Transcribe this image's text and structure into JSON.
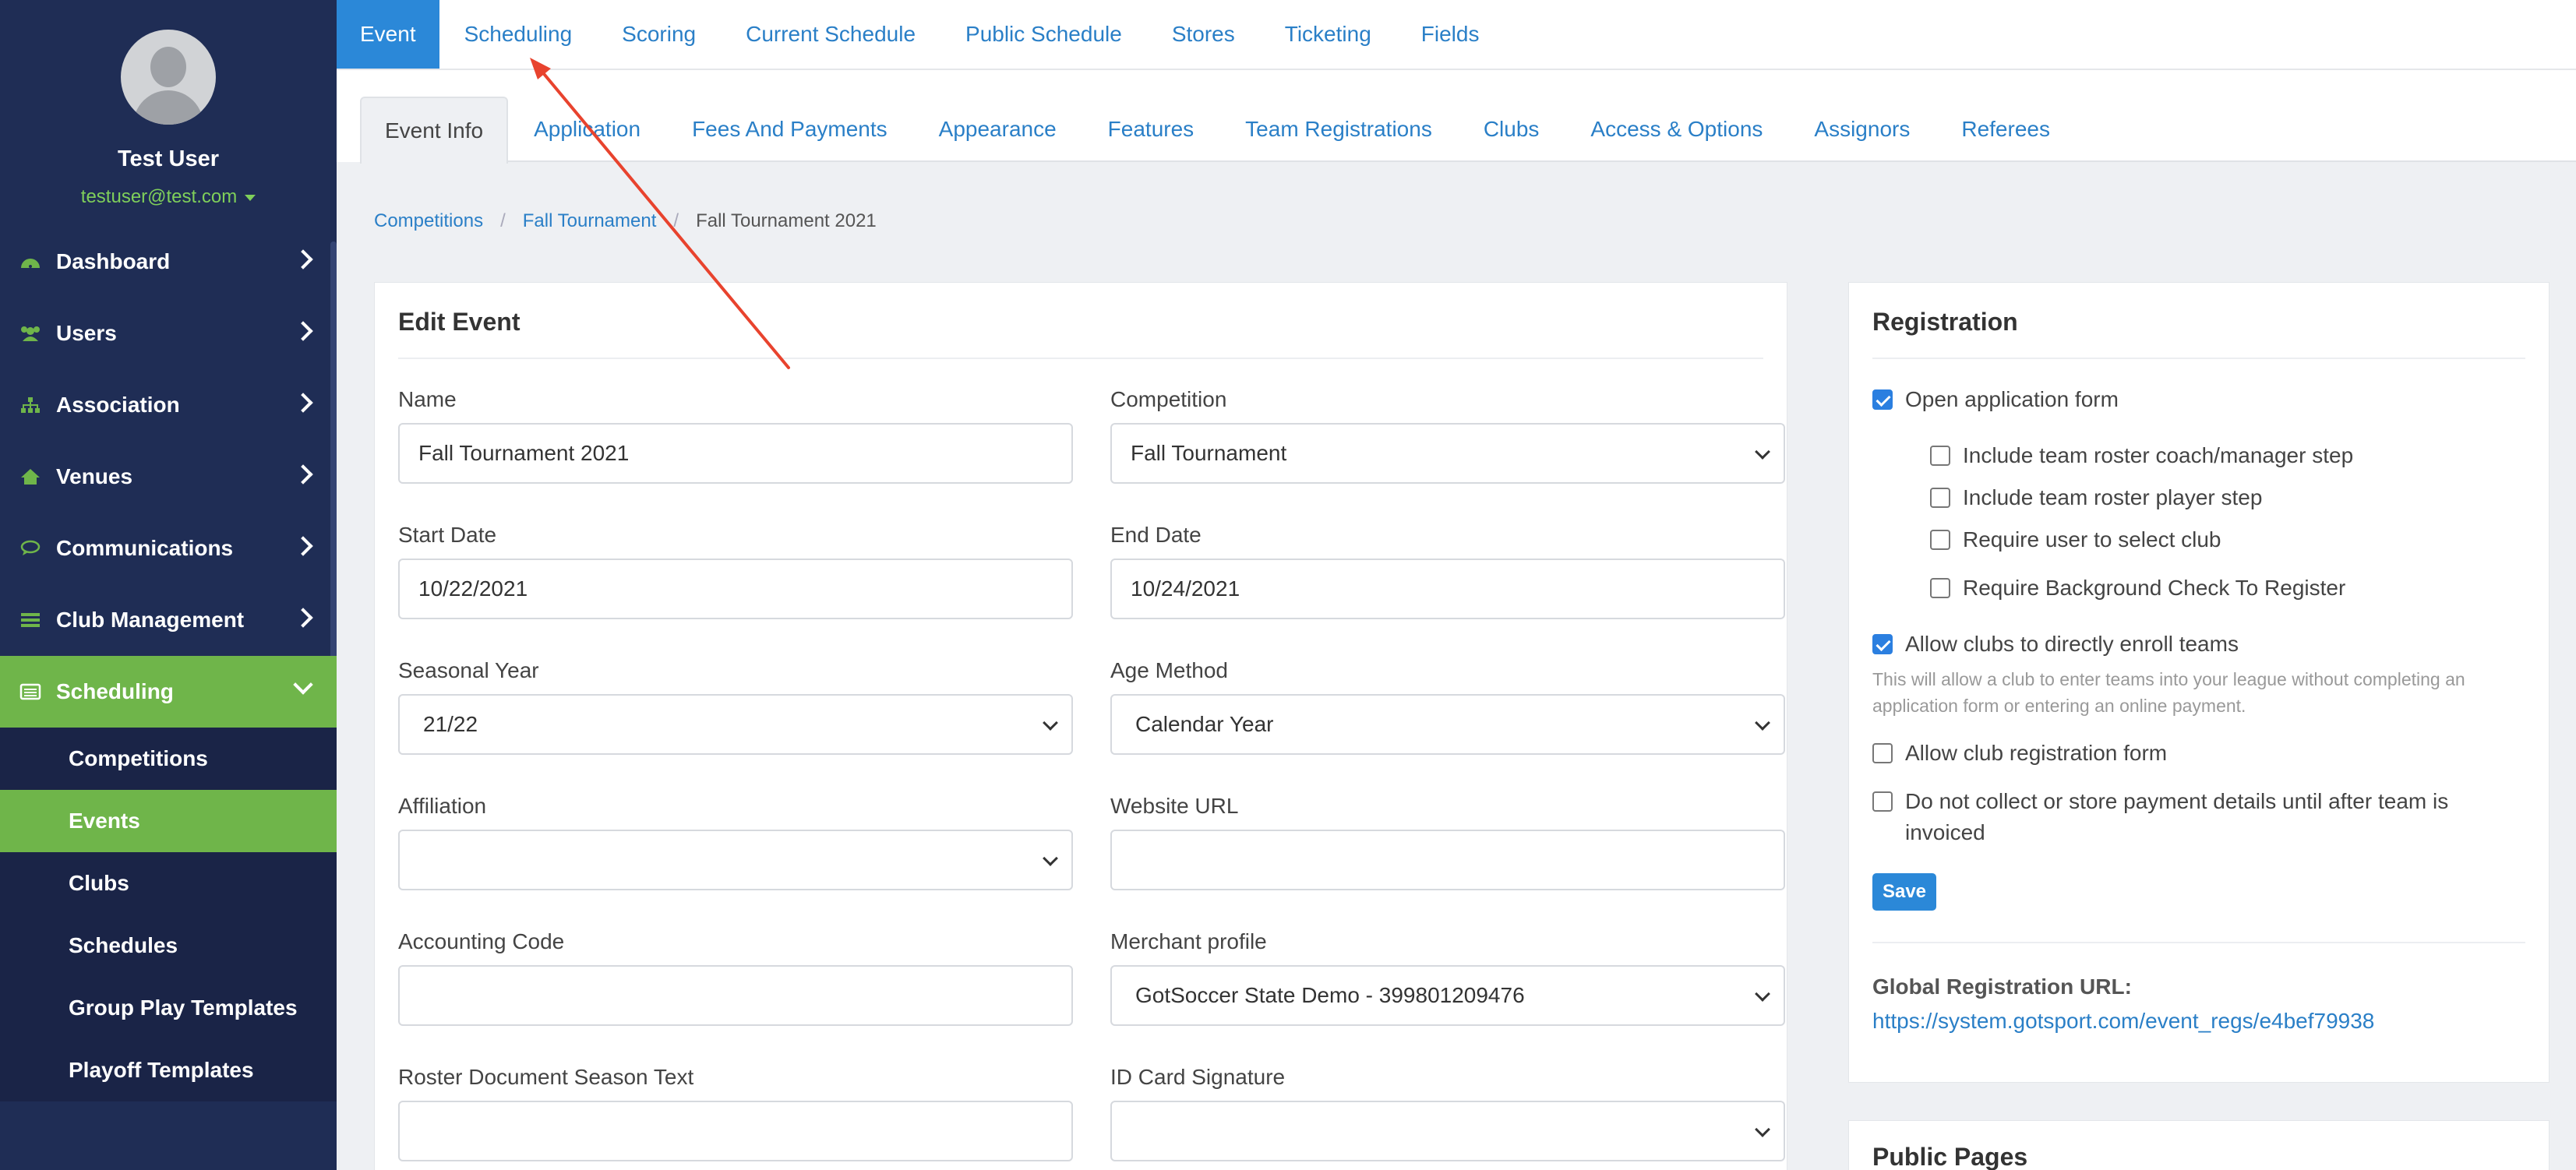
{
  "user": {
    "name": "Test User",
    "email": "testuser@test.com"
  },
  "sidebar": {
    "items": [
      {
        "label": "Dashboard",
        "icon": "dashboard-icon"
      },
      {
        "label": "Users",
        "icon": "users-icon"
      },
      {
        "label": "Association",
        "icon": "sitemap-icon"
      },
      {
        "label": "Venues",
        "icon": "home-icon"
      },
      {
        "label": "Communications",
        "icon": "chat-icon"
      },
      {
        "label": "Club Management",
        "icon": "list-icon"
      },
      {
        "label": "Scheduling",
        "icon": "calendar-list-icon"
      }
    ],
    "sub_items": [
      "Competitions",
      "Events",
      "Clubs",
      "Schedules",
      "Group Play Templates",
      "Playoff Templates"
    ]
  },
  "topnav": [
    "Event",
    "Scheduling",
    "Scoring",
    "Current Schedule",
    "Public Schedule",
    "Stores",
    "Ticketing",
    "Fields"
  ],
  "subnav": [
    "Event Info",
    "Application",
    "Fees And Payments",
    "Appearance",
    "Features",
    "Team Registrations",
    "Clubs",
    "Access & Options",
    "Assignors",
    "Referees"
  ],
  "breadcrumb": [
    "Competitions",
    "Fall Tournament",
    "Fall Tournament 2021"
  ],
  "edit_event": {
    "title": "Edit Event",
    "fields": {
      "name": {
        "label": "Name",
        "value": "Fall Tournament 2021"
      },
      "competition": {
        "label": "Competition",
        "value": "Fall Tournament"
      },
      "start_date": {
        "label": "Start Date",
        "value": "10/22/2021"
      },
      "end_date": {
        "label": "End Date",
        "value": "10/24/2021"
      },
      "seasonal_year": {
        "label": "Seasonal Year",
        "value": "21/22"
      },
      "age_method": {
        "label": "Age Method",
        "value": "Calendar Year"
      },
      "affiliation": {
        "label": "Affiliation",
        "value": ""
      },
      "website_url": {
        "label": "Website URL",
        "value": ""
      },
      "accounting_code": {
        "label": "Accounting Code",
        "value": ""
      },
      "merchant_profile": {
        "label": "Merchant profile",
        "value": "GotSoccer State Demo - 399801209476"
      },
      "roster_text": {
        "label": "Roster Document Season Text",
        "value": ""
      },
      "id_card_signature": {
        "label": "ID Card Signature",
        "value": ""
      }
    }
  },
  "registration": {
    "title": "Registration",
    "open_form": "Open application form",
    "include_coach": "Include team roster coach/manager step",
    "include_player": "Include team roster player step",
    "require_club": "Require user to select club",
    "require_bg": "Require Background Check To Register",
    "allow_enroll": "Allow clubs to directly enroll teams",
    "allow_enroll_help": "This will allow a club to enter teams into your league without completing an application form or entering an online payment.",
    "allow_club_form": "Allow club registration form",
    "no_payment": "Do not collect or store payment details until after team is invoiced",
    "save": "Save",
    "url_label": "Global Registration URL:",
    "url": "https://system.gotsport.com/event_regs/e4bef79938"
  },
  "public_pages": {
    "title": "Public Pages"
  },
  "colors": {
    "sidebar": "#1f2d55",
    "accent_green": "#6fb54a",
    "link_blue": "#2a7fc7",
    "annotation_red": "#e8432e"
  }
}
